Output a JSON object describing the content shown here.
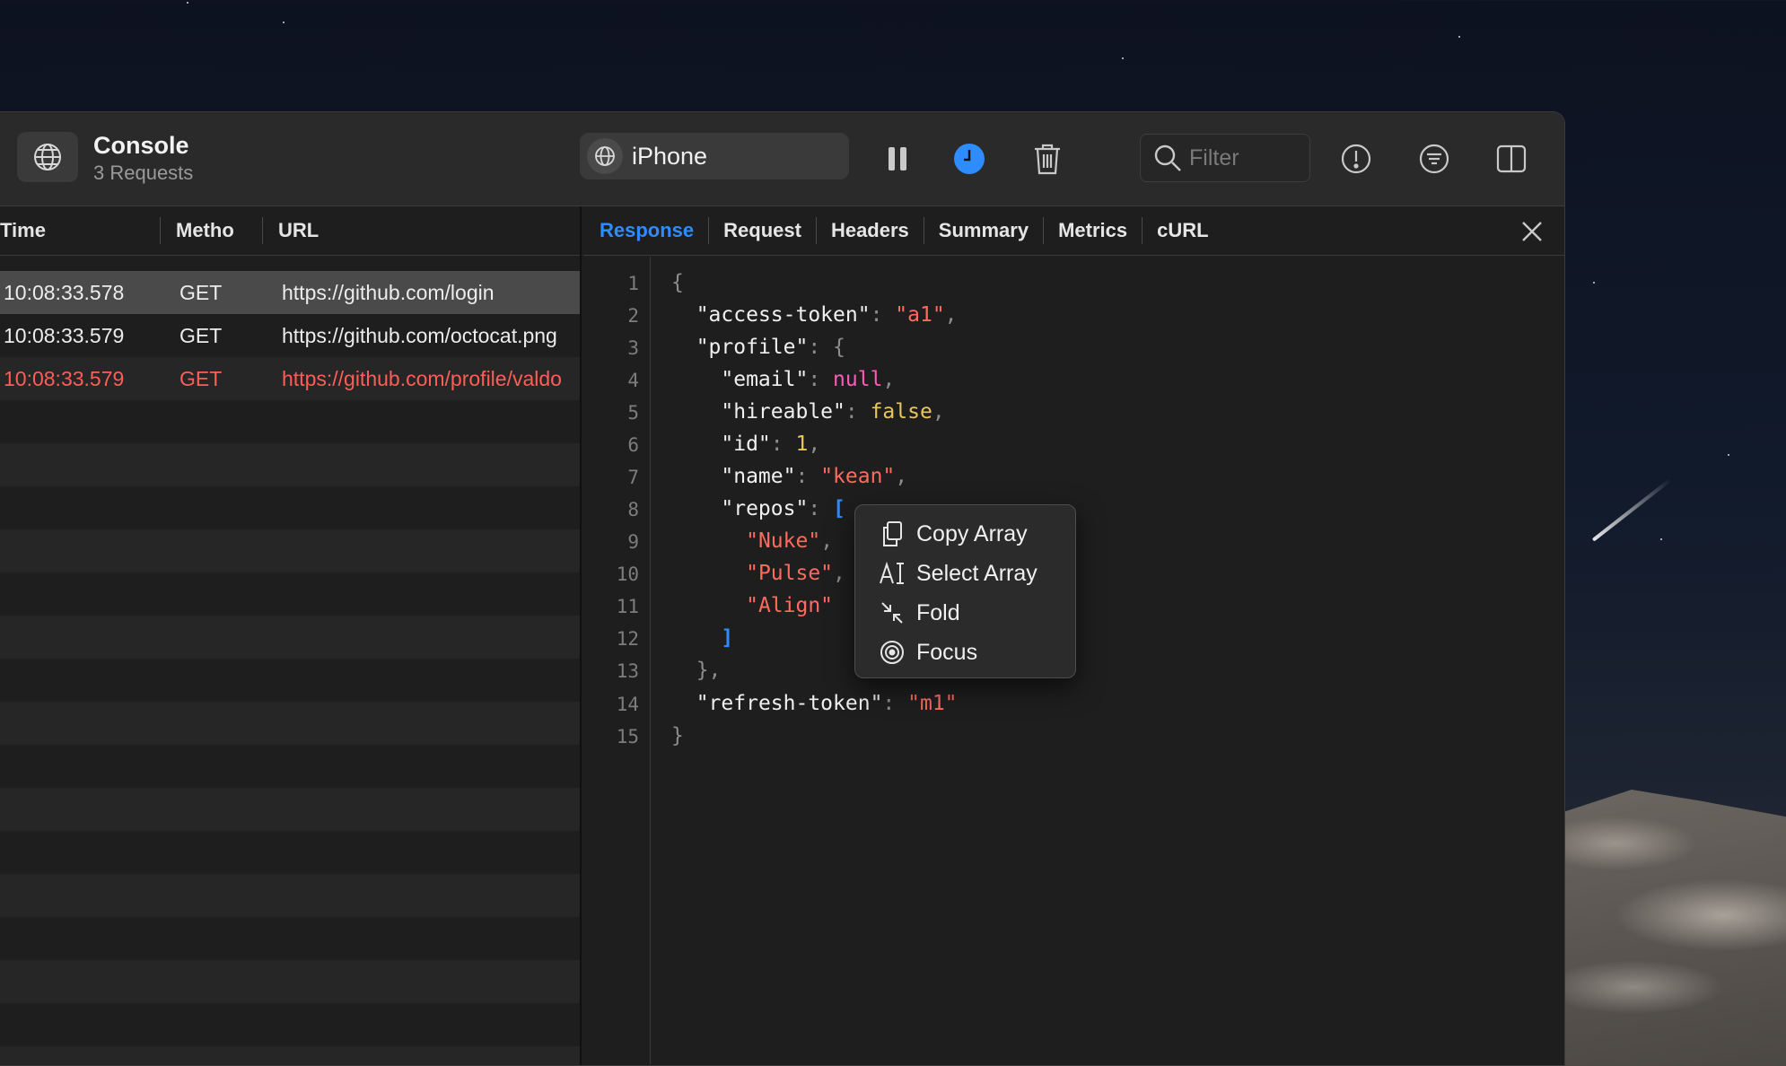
{
  "window": {
    "app_title": "Console",
    "app_subtitle": "3 Requests"
  },
  "toolbar": {
    "device_label": "iPhone",
    "filter_placeholder": "Filter",
    "accent_color": "#2f8cff"
  },
  "list": {
    "columns": [
      "Time",
      "Metho",
      "URL"
    ],
    "rows": [
      {
        "time": "10:08:33.578",
        "method": "GET",
        "url": "https://github.com/login",
        "status": "selected"
      },
      {
        "time": "10:08:33.579",
        "method": "GET",
        "url": "https://github.com/octocat.png",
        "status": "normal"
      },
      {
        "time": "10:08:33.579",
        "method": "GET",
        "url": "https://github.com/profile/valdo",
        "status": "error"
      }
    ]
  },
  "detail": {
    "tabs": [
      "Response",
      "Request",
      "Headers",
      "Summary",
      "Metrics",
      "cURL"
    ],
    "active_tab": "Response",
    "line_numbers": [
      "1",
      "2",
      "3",
      "4",
      "5",
      "6",
      "7",
      "8",
      "9",
      "10",
      "11",
      "12",
      "13",
      "14",
      "15"
    ],
    "json": {
      "l1_open": "{",
      "access_token_key": "\"access-token\"",
      "access_token_val": "\"a1\"",
      "profile_key": "\"profile\"",
      "email_key": "\"email\"",
      "email_val": "null",
      "hireable_key": "\"hireable\"",
      "hireable_val": "false",
      "id_key": "\"id\"",
      "id_val": "1",
      "name_key": "\"name\"",
      "name_val": "\"kean\"",
      "repos_key": "\"repos\"",
      "repo1": "\"Nuke\"",
      "repo2": "\"Pulse\"",
      "repo3": "\"Align\"",
      "refresh_token_key": "\"refresh-token\"",
      "refresh_token_val": "\"m1\""
    }
  },
  "context_menu": {
    "items": [
      {
        "label": "Copy Array",
        "icon": "copy-icon"
      },
      {
        "label": "Select Array",
        "icon": "text-select-icon"
      },
      {
        "label": "Fold",
        "icon": "fold-arrows-icon"
      },
      {
        "label": "Focus",
        "icon": "target-icon"
      }
    ]
  }
}
